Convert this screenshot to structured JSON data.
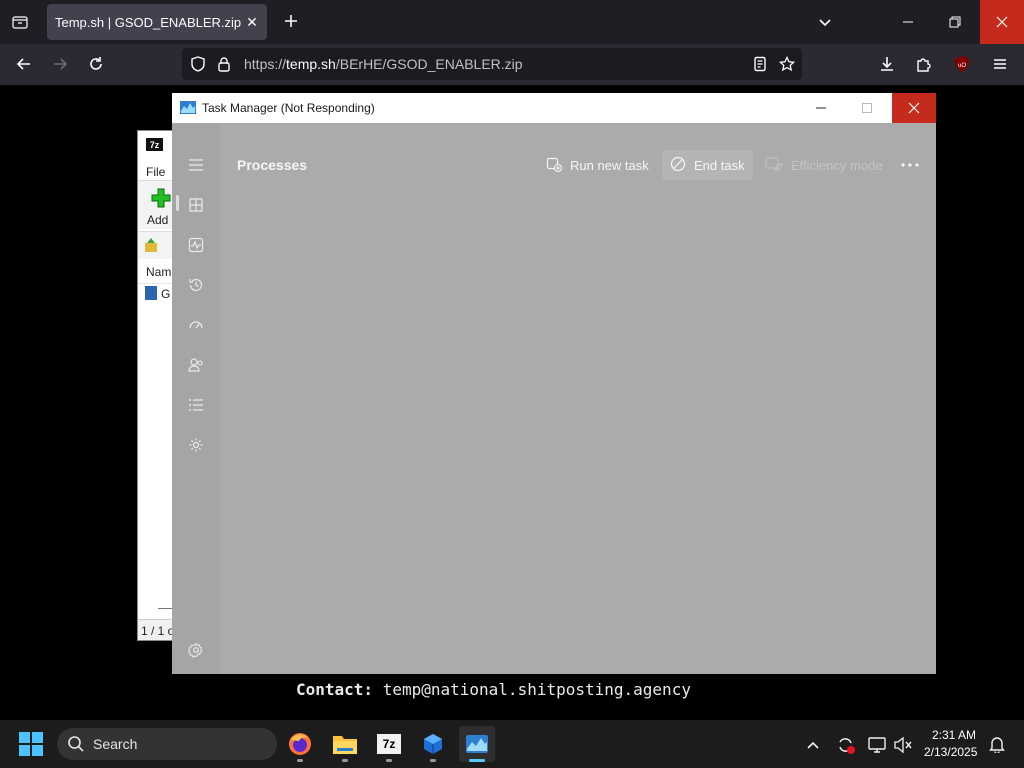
{
  "browser": {
    "tab_title": "Temp.sh | GSOD_ENABLER.zip",
    "tab_close": "✕",
    "url_prefix": "https://",
    "url_domain": "temp.sh",
    "url_path": "/BErHE/GSOD_ENABLER.zip"
  },
  "sevenzip": {
    "logo": "7z",
    "menu_file": "File",
    "toolbar_add": "Add",
    "column_name": "Nam",
    "row_name": "G",
    "status": "1 / 1 o"
  },
  "task_manager": {
    "title": "Task Manager (Not Responding)",
    "section_title": "Processes",
    "commands": {
      "run_new_task": "Run new task",
      "end_task": "End task",
      "efficiency_mode": "Efficiency mode"
    }
  },
  "contact": {
    "label": "Contact:",
    "value": "temp@national.shitposting.agency"
  },
  "taskbar": {
    "search_label": "Search",
    "time": "2:31 AM",
    "date": "2/13/2025",
    "sevenzip_label": "7z"
  },
  "colors": {
    "close_red": "#c42b1c",
    "taskbar_bg": "#1c1c1c",
    "tm_overlay": "#a5a5a5"
  }
}
